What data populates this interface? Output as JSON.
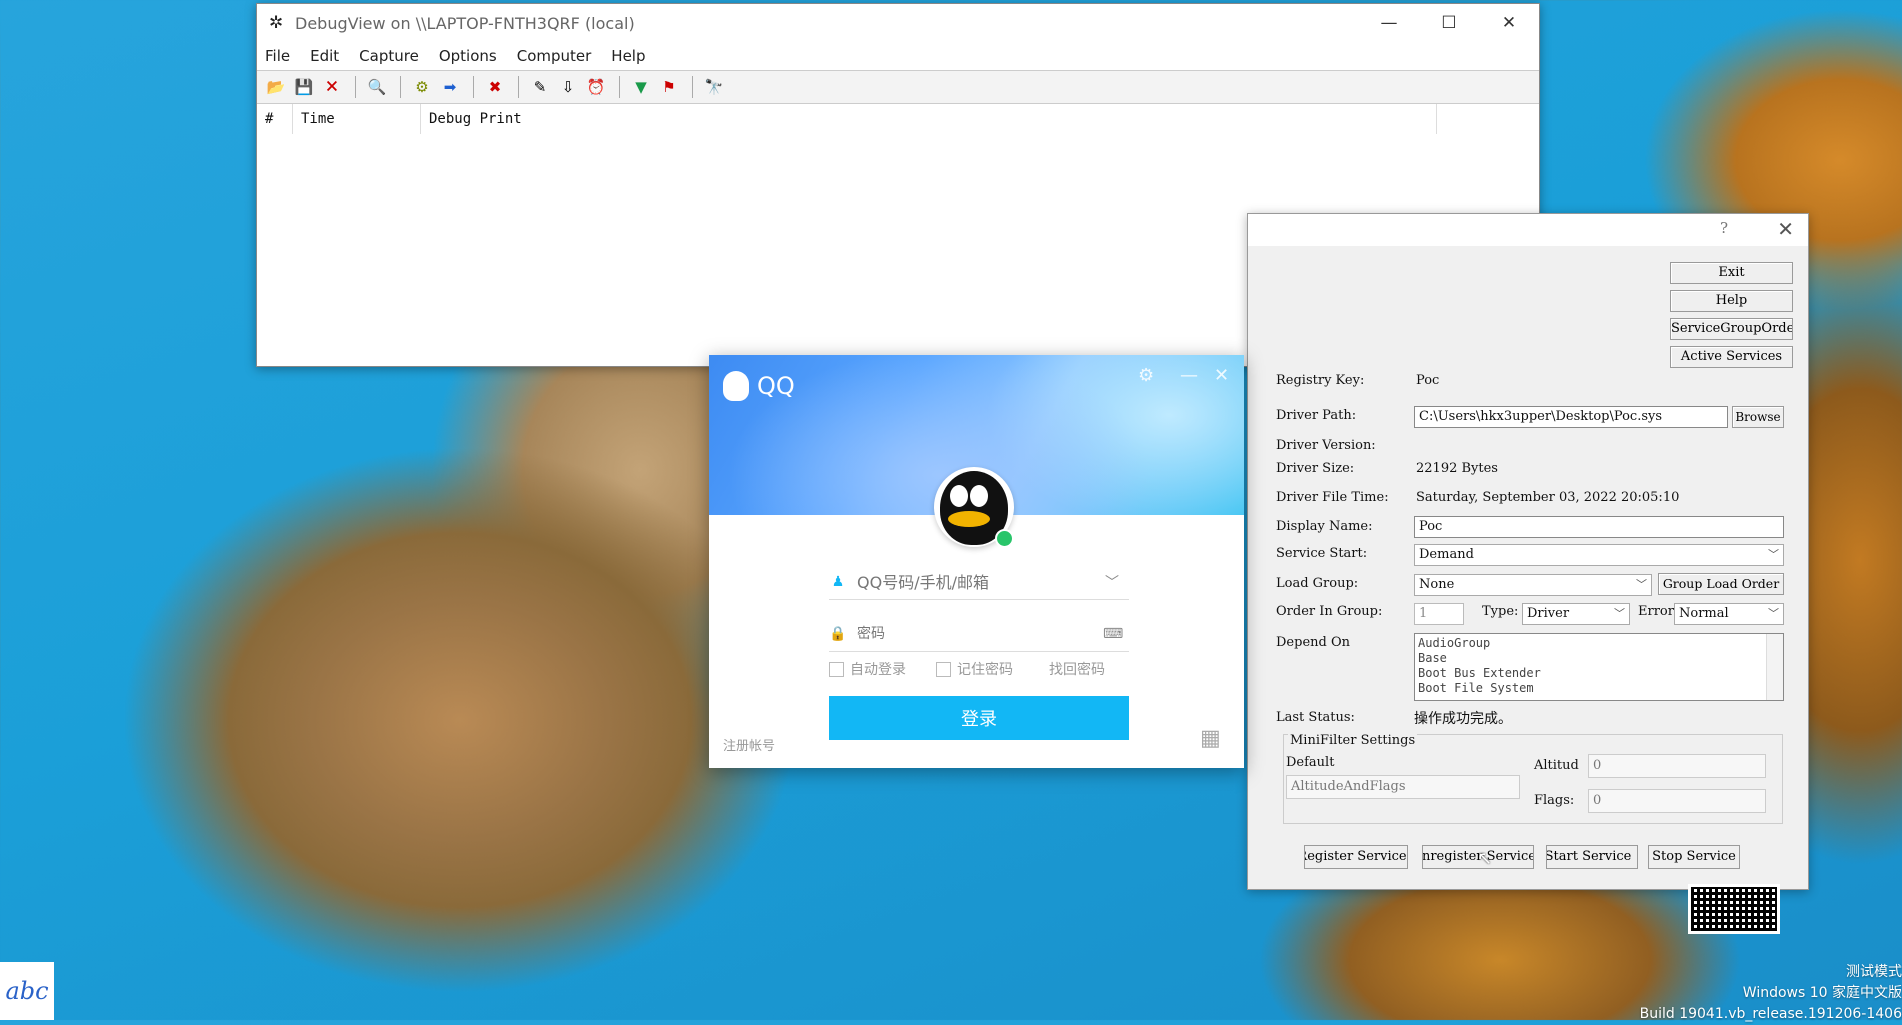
{
  "debugview": {
    "title": "DebugView on \\\\LAPTOP-FNTH3QRF (local)",
    "menu": [
      "File",
      "Edit",
      "Capture",
      "Options",
      "Computer",
      "Help"
    ],
    "columns": [
      "#",
      "Time",
      "Debug Print"
    ],
    "window_controls": {
      "minimize": "—",
      "maximize": "☐",
      "close": "✕"
    }
  },
  "qq": {
    "logo_text": "QQ",
    "account_placeholder": "QQ号码/手机/邮箱",
    "password_placeholder": "密码",
    "auto_login": "自动登录",
    "remember_password": "记住密码",
    "find_password": "找回密码",
    "login_button": "登录",
    "register": "注册帐号"
  },
  "driver": {
    "buttons": {
      "exit": "Exit",
      "help": "Help",
      "service_group_order": "ServiceGroupOrder",
      "active_services": "Active Services",
      "browse": "Browse",
      "group_load_order": "Group Load Order"
    },
    "labels": {
      "registry_key": "Registry Key:",
      "driver_path": "Driver Path:",
      "driver_version": "Driver Version:",
      "driver_size": "Driver Size:",
      "driver_file_time": "Driver File Time:",
      "display_name": "Display Name:",
      "service_start": "Service Start:",
      "load_group": "Load Group:",
      "order_in_group": "Order In Group:",
      "type": "Type:",
      "error": "Error",
      "depend_on": "Depend On",
      "last_status": "Last Status:"
    },
    "values": {
      "registry_key": "Poc",
      "driver_path": "C:\\Users\\hkx3upper\\Desktop\\Poc.sys",
      "driver_size": "22192 Bytes",
      "driver_file_time": "Saturday, September 03, 2022 20:05:10",
      "display_name": "Poc",
      "service_start": "Demand",
      "load_group": "None",
      "order_in_group": "1",
      "type": "Driver",
      "error": "Normal",
      "last_status": "操作成功完成。"
    },
    "depend_list": [
      "AudioGroup",
      "Base",
      "Boot Bus Extender",
      "Boot File System"
    ],
    "minifilter": {
      "title": "MiniFilter Settings",
      "default_label": "Default",
      "default_value": "AltitudeAndFlags",
      "altitude_label": "Altitud",
      "altitude_value": "0",
      "flags_label": "Flags:",
      "flags_value": "0"
    },
    "bottom_buttons": [
      "Register Service",
      "Unregister Service",
      "Start Service",
      "Stop Service"
    ]
  },
  "taskbar": {
    "ime": "abc"
  },
  "watermark": [
    "测试模式",
    "Windows 10 家庭中文版",
    "Build 19041.vb_release.191206-1406"
  ]
}
